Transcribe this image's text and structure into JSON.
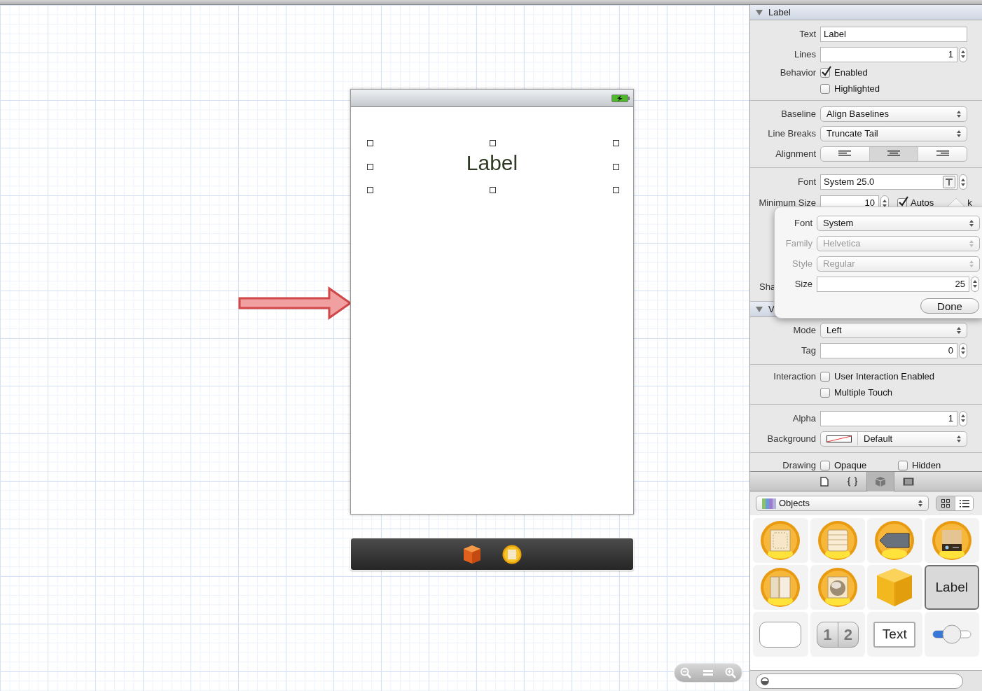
{
  "canvas": {
    "view_label": "Label",
    "label_selected": true
  },
  "inspector": {
    "sections": [
      {
        "title": "Label",
        "expanded": true,
        "rows": [
          {
            "kind": "text",
            "label": "Text",
            "value": "Label"
          },
          {
            "kind": "stepper",
            "label": "Lines",
            "value": "1"
          },
          {
            "kind": "checks",
            "label": "Behavior",
            "items": [
              {
                "label": "Enabled",
                "checked": true
              },
              {
                "label": "Highlighted",
                "checked": false
              }
            ]
          }
        ]
      },
      {
        "rows": [
          {
            "kind": "select",
            "label": "Baseline",
            "value": "Align Baselines"
          },
          {
            "kind": "select",
            "label": "Line Breaks",
            "value": "Truncate Tail"
          },
          {
            "kind": "segmented",
            "label": "Alignment",
            "segments": [
              {
                "selected": false
              },
              {
                "selected": true
              },
              {
                "selected": false
              }
            ]
          }
        ]
      },
      {
        "rows": [
          {
            "kind": "font",
            "label": "Font",
            "value": "System 25.0"
          },
          {
            "kind": "minsize",
            "label": "Minimum Size",
            "value": "10",
            "check": {
              "label": "Autos",
              "tail": "k",
              "checked": true
            }
          },
          {
            "kind": "blank"
          },
          {
            "kind": "covered",
            "label": "Sha"
          }
        ]
      },
      {
        "title": "V",
        "expanded": true,
        "rows": [
          {
            "kind": "select",
            "label": "Mode",
            "value": "Left"
          },
          {
            "kind": "stepper",
            "label": "Tag",
            "value": "0"
          }
        ]
      },
      {
        "rows": [
          {
            "kind": "checks",
            "label": "Interaction",
            "items": [
              {
                "label": "User Interaction Enabled",
                "checked": false
              },
              {
                "label": "Multiple Touch",
                "checked": false
              }
            ]
          }
        ]
      },
      {
        "rows": [
          {
            "kind": "stepper",
            "label": "Alpha",
            "value": "1"
          },
          {
            "kind": "color",
            "label": "Background",
            "value": "Default"
          }
        ]
      },
      {
        "rows": [
          {
            "kind": "inline-checks",
            "label": "Drawing",
            "items": [
              {
                "label": "Opaque",
                "checked": false
              },
              {
                "label": "Hidden",
                "checked": false
              }
            ]
          }
        ]
      }
    ]
  },
  "font_popover": {
    "rows": [
      {
        "kind": "select",
        "label": "Font",
        "value": "System",
        "disabled": false
      },
      {
        "kind": "select",
        "label": "Family",
        "value": "Helvetica",
        "disabled": true
      },
      {
        "kind": "select",
        "label": "Style",
        "value": "Regular",
        "disabled": true
      },
      {
        "kind": "stepper",
        "label": "Size",
        "value": "25",
        "disabled": false
      }
    ],
    "button": "Done"
  },
  "library": {
    "tabs": [
      {
        "kind": "file",
        "selected": false
      },
      {
        "kind": "braces",
        "selected": false
      },
      {
        "kind": "cube",
        "selected": true
      },
      {
        "kind": "media",
        "selected": false
      }
    ],
    "dropdown": "Objects",
    "view_modes": [
      {
        "kind": "grid",
        "selected": true
      },
      {
        "kind": "list",
        "selected": false
      }
    ],
    "objects": [
      {
        "kind": "view",
        "selected": false
      },
      {
        "kind": "table",
        "selected": false
      },
      {
        "kind": "nav",
        "selected": false
      },
      {
        "kind": "tabbar",
        "selected": false
      },
      {
        "kind": "split",
        "selected": false
      },
      {
        "kind": "image",
        "selected": false
      },
      {
        "kind": "cube",
        "selected": false
      },
      {
        "kind": "label",
        "text": "Label",
        "selected": true
      },
      {
        "kind": "button",
        "selected": false
      },
      {
        "kind": "segmented",
        "segments": [
          "1",
          "2"
        ],
        "selected": false
      },
      {
        "kind": "textfield",
        "text": "Text",
        "selected": false
      },
      {
        "kind": "switch",
        "selected": false
      }
    ]
  }
}
